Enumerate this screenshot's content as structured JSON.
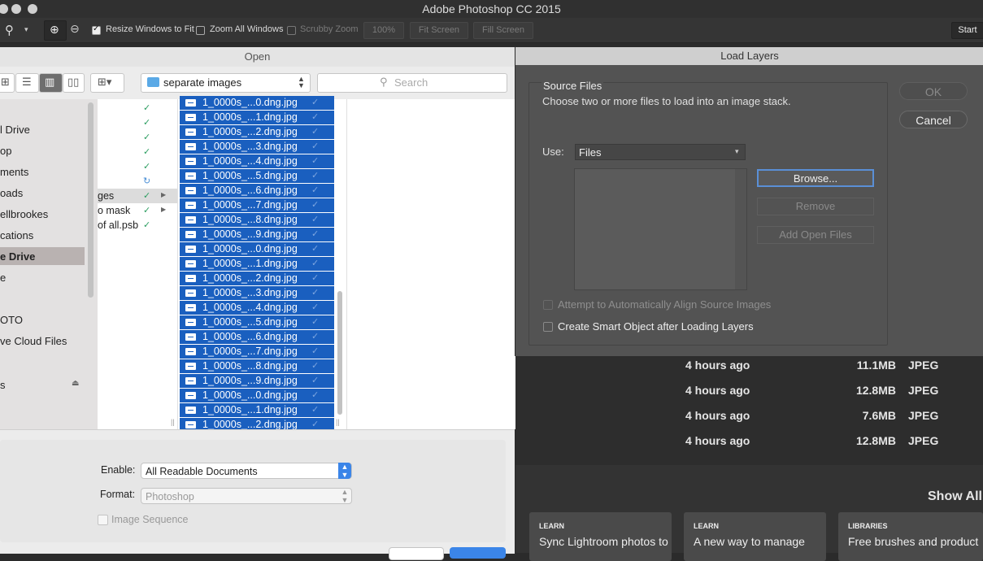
{
  "app": {
    "title": "Adobe Photoshop CC 2015"
  },
  "options_bar": {
    "resize_windows": "Resize Windows to Fit",
    "zoom_all": "Zoom All Windows",
    "scrubby_zoom": "Scrubby Zoom",
    "zoom_value": "100%",
    "fit_screen": "Fit Screen",
    "fill_screen": "Fill Screen",
    "start": "Start"
  },
  "open_dialog": {
    "title": "Open",
    "location": "separate images",
    "search_placeholder": "Search",
    "sidebar": [
      "l Drive",
      "op",
      "ments",
      "oads",
      "ellbrookes",
      "cations",
      "e Drive",
      "e",
      "OTO",
      "ve Cloud Files",
      "s"
    ],
    "column1": [
      "ges",
      "o mask",
      "of all.psb"
    ],
    "files": [
      "1_0000s_...0.dng.jpg",
      "1_0000s_...1.dng.jpg",
      "1_0000s_...2.dng.jpg",
      "1_0000s_...3.dng.jpg",
      "1_0000s_...4.dng.jpg",
      "1_0000s_...5.dng.jpg",
      "1_0000s_...6.dng.jpg",
      "1_0000s_...7.dng.jpg",
      "1_0000s_...8.dng.jpg",
      "1_0000s_...9.dng.jpg",
      "1_0000s_...0.dng.jpg",
      "1_0000s_...1.dng.jpg",
      "1_0000s_...2.dng.jpg",
      "1_0000s_...3.dng.jpg",
      "1_0000s_...4.dng.jpg",
      "1_0000s_...5.dng.jpg",
      "1_0000s_...6.dng.jpg",
      "1_0000s_...7.dng.jpg",
      "1_0000s_...8.dng.jpg",
      "1_0000s_...9.dng.jpg",
      "1_0000s_...0.dng.jpg",
      "1_0000s_...1.dng.jpg",
      "1_0000s_...2.dng.jpg"
    ],
    "enable_label": "Enable:",
    "enable_value": "All Readable Documents",
    "format_label": "Format:",
    "format_value": "Photoshop",
    "image_sequence": "Image Sequence"
  },
  "load_layers": {
    "title": "Load Layers",
    "group_title": "Source Files",
    "description": "Choose two or more files to load into an image stack.",
    "use_label": "Use:",
    "use_value": "Files",
    "ok": "OK",
    "cancel": "Cancel",
    "browse": "Browse...",
    "remove": "Remove",
    "add_open_files": "Add Open Files",
    "align_label": "Attempt to Automatically Align Source Images",
    "smart_object_label": "Create Smart Object after Loading Layers"
  },
  "home": {
    "recent": [
      {
        "time": "4 hours ago",
        "size": "11.1MB",
        "type": "JPEG"
      },
      {
        "time": "4 hours ago",
        "size": "12.8MB",
        "type": "JPEG"
      },
      {
        "time": "4 hours ago",
        "size": "7.6MB",
        "type": "JPEG"
      },
      {
        "time": "4 hours ago",
        "size": "12.8MB",
        "type": "JPEG"
      }
    ],
    "show_all": "Show All",
    "cards": [
      {
        "tag": "LEARN",
        "title": "Sync Lightroom photos to"
      },
      {
        "tag": "LEARN",
        "title": "A new way to manage"
      },
      {
        "tag": "LIBRARIES",
        "title": "Free brushes and product"
      }
    ]
  }
}
